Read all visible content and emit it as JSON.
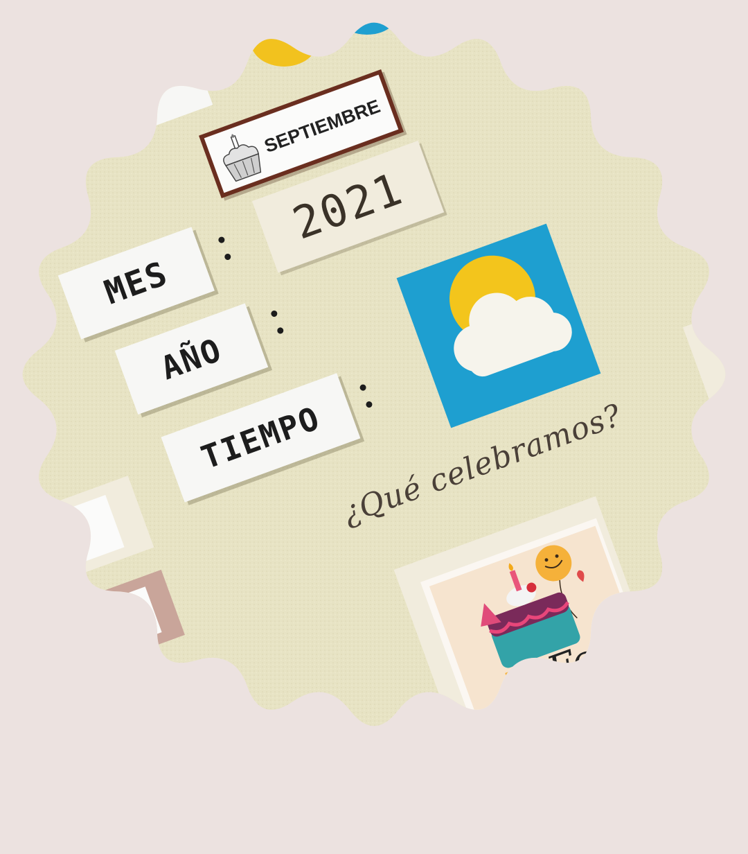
{
  "labels": {
    "mes": "MES",
    "anio": "AÑO",
    "tiempo": "TIEMPO"
  },
  "values": {
    "month": "SEPTIEMBRE",
    "year": "2021"
  },
  "question": "¿Qué celebramos?",
  "weather_icon": "sun-behind-cloud-icon",
  "colors": {
    "background": "#ece2e0",
    "felt_board": "#e6e2c2",
    "weather_square": "#1e9fd0",
    "sun": "#f3c51c",
    "cloud": "#f6f4ec",
    "month_felt": "#6a2e1f"
  }
}
